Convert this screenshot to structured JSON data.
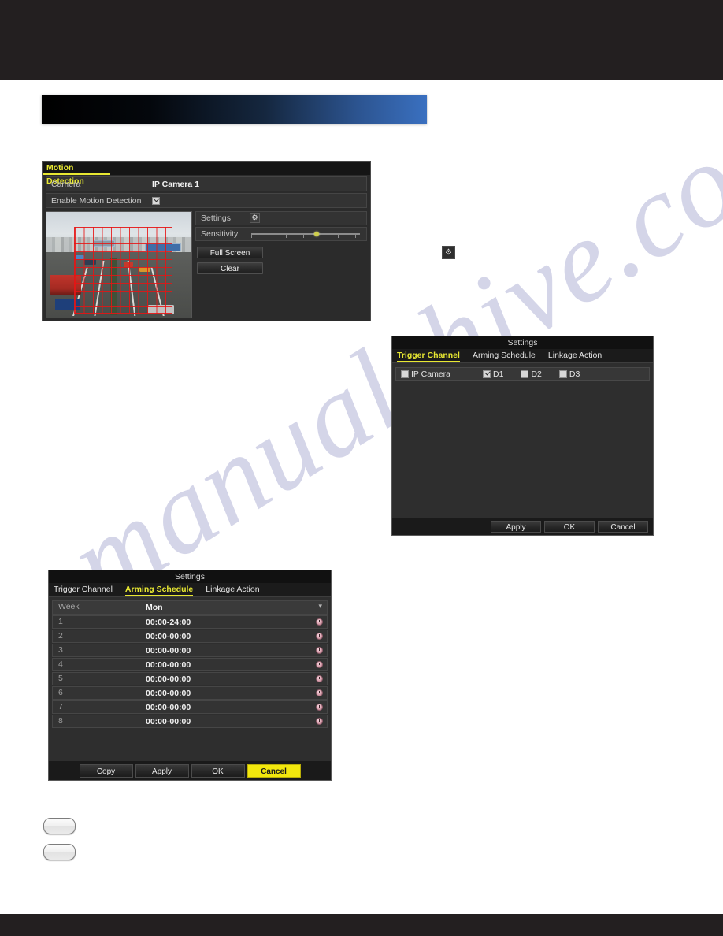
{
  "page": {
    "watermark_text": "manualshive.com",
    "header_bar_color": "#231f20",
    "footer_bar_color": "#231f20",
    "banner_gradient_from": "#000000",
    "banner_gradient_to": "#3a70c0"
  },
  "motion_detection": {
    "title": "Motion Detection",
    "accent_color": "#e8e832",
    "camera": {
      "label": "Camera",
      "value": "IP Camera 1",
      "caret": "chevron-down-icon"
    },
    "enable": {
      "label": "Enable Motion Detection",
      "checked": true
    },
    "settings": {
      "label": "Settings",
      "icon": "gear-icon"
    },
    "sensitivity": {
      "label": "Sensitivity",
      "value_percent": 58,
      "knob_color": "#cfcf4c"
    },
    "buttons": {
      "full_screen": "Full Screen",
      "clear": "Clear"
    },
    "preview": {
      "description": "traffic scene with red motion grid overlay",
      "grid_color": "#e61414"
    }
  },
  "mid_gear_icon": {
    "icon": "gear-icon"
  },
  "trigger_channel_dialog": {
    "title": "Settings",
    "tabs": [
      {
        "label": "Trigger Channel",
        "active": true
      },
      {
        "label": "Arming Schedule",
        "active": false
      },
      {
        "label": "Linkage Action",
        "active": false
      }
    ],
    "channels": [
      {
        "label": "IP Camera",
        "checked": false
      },
      {
        "label": "D1",
        "checked": true
      },
      {
        "label": "D2",
        "checked": false
      },
      {
        "label": "D3",
        "checked": false
      }
    ],
    "buttons": [
      {
        "label": "Apply",
        "highlight": false
      },
      {
        "label": "OK",
        "highlight": false
      },
      {
        "label": "Cancel",
        "highlight": false
      }
    ]
  },
  "arming_schedule_dialog": {
    "title": "Settings",
    "tabs": [
      {
        "label": "Trigger Channel",
        "active": false
      },
      {
        "label": "Arming Schedule",
        "active": true
      },
      {
        "label": "Linkage Action",
        "active": false
      }
    ],
    "week": {
      "label": "Week",
      "value": "Mon",
      "caret": "chevron-down-icon"
    },
    "rows": [
      {
        "index": "1",
        "time": "00:00-24:00"
      },
      {
        "index": "2",
        "time": "00:00-00:00"
      },
      {
        "index": "3",
        "time": "00:00-00:00"
      },
      {
        "index": "4",
        "time": "00:00-00:00"
      },
      {
        "index": "5",
        "time": "00:00-00:00"
      },
      {
        "index": "6",
        "time": "00:00-00:00"
      },
      {
        "index": "7",
        "time": "00:00-00:00"
      },
      {
        "index": "8",
        "time": "00:00-00:00"
      }
    ],
    "buttons": [
      {
        "label": "Copy",
        "highlight": false
      },
      {
        "label": "Apply",
        "highlight": false
      },
      {
        "label": "OK",
        "highlight": false
      },
      {
        "label": "Cancel",
        "highlight": true
      }
    ]
  }
}
